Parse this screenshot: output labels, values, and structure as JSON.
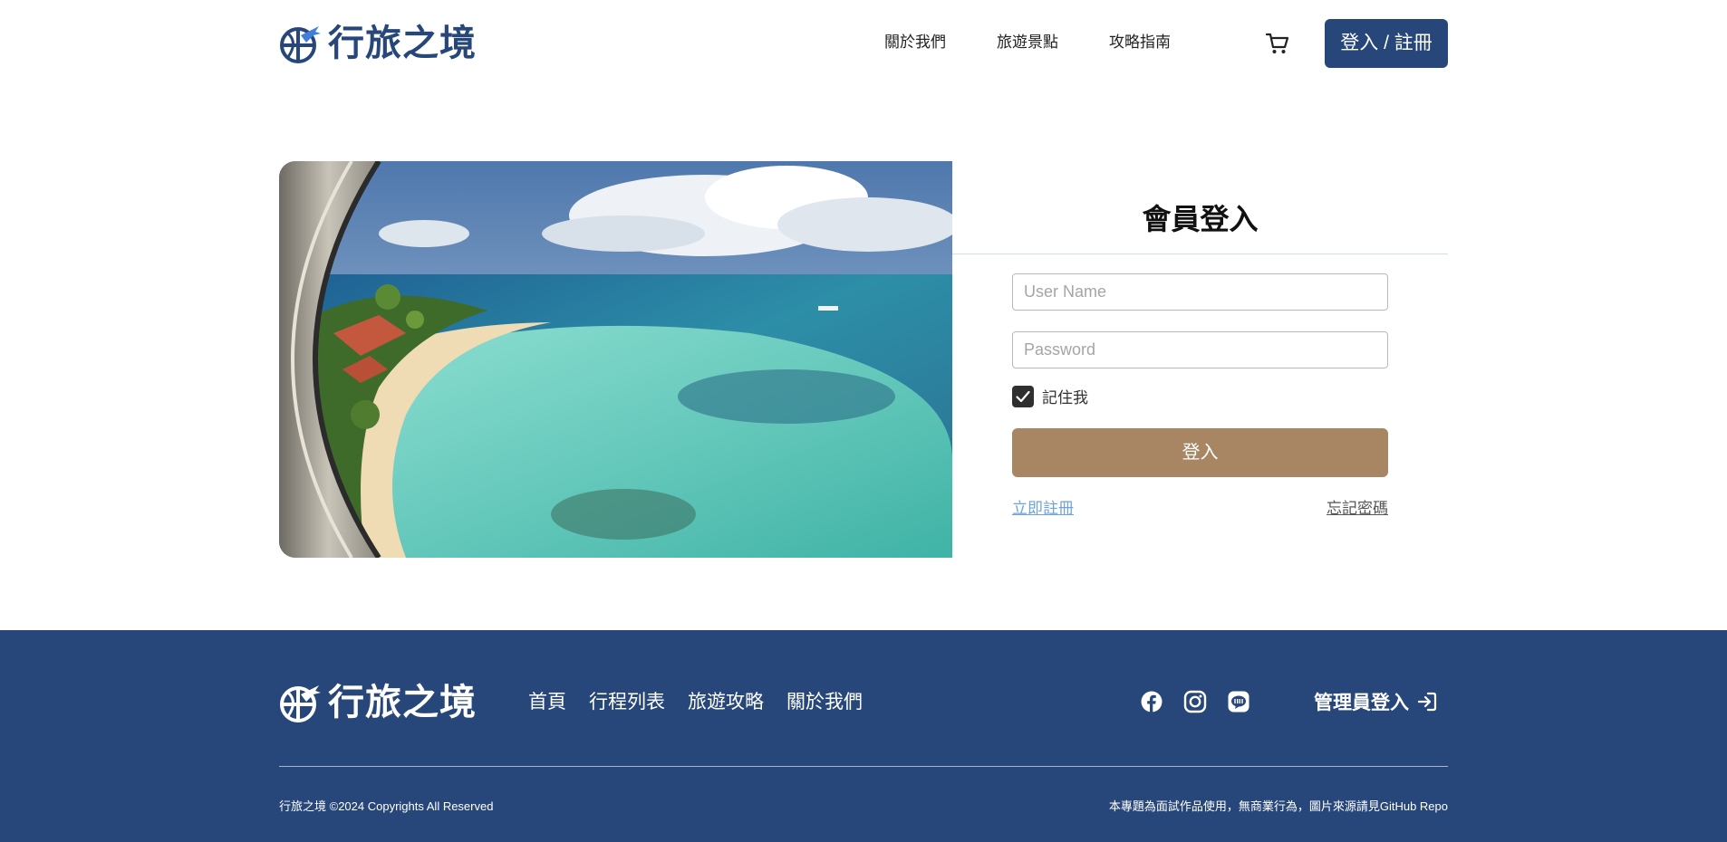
{
  "brand": {
    "name": "行旅之境",
    "color": "#27477a"
  },
  "header": {
    "nav": [
      "關於我們",
      "旅遊景點",
      "攻略指南"
    ],
    "cart_icon": "cart-icon",
    "login_button": "登入 / 註冊"
  },
  "hero": {
    "image": "airplane-window-beach-view"
  },
  "login_form": {
    "title": "會員登入",
    "username_placeholder": "User Name",
    "password_placeholder": "Password",
    "remember_me": {
      "label": "記住我",
      "checked": true
    },
    "submit_label": "登入",
    "register_link": "立即註冊",
    "forgot_link": "忘記密碼",
    "submit_color": "#a88563"
  },
  "footer": {
    "brand": "行旅之境",
    "nav": [
      "首頁",
      "行程列表",
      "旅遊攻略",
      "關於我們"
    ],
    "social_icons": [
      "facebook-icon",
      "instagram-icon",
      "line-icon"
    ],
    "admin_login": "管理員登入",
    "copyright": "行旅之境 ©2024 Copyrights All Reserved",
    "disclaimer": "本專題為面試作品使用，無商業行為，圖片來源請見GitHub Repo"
  }
}
